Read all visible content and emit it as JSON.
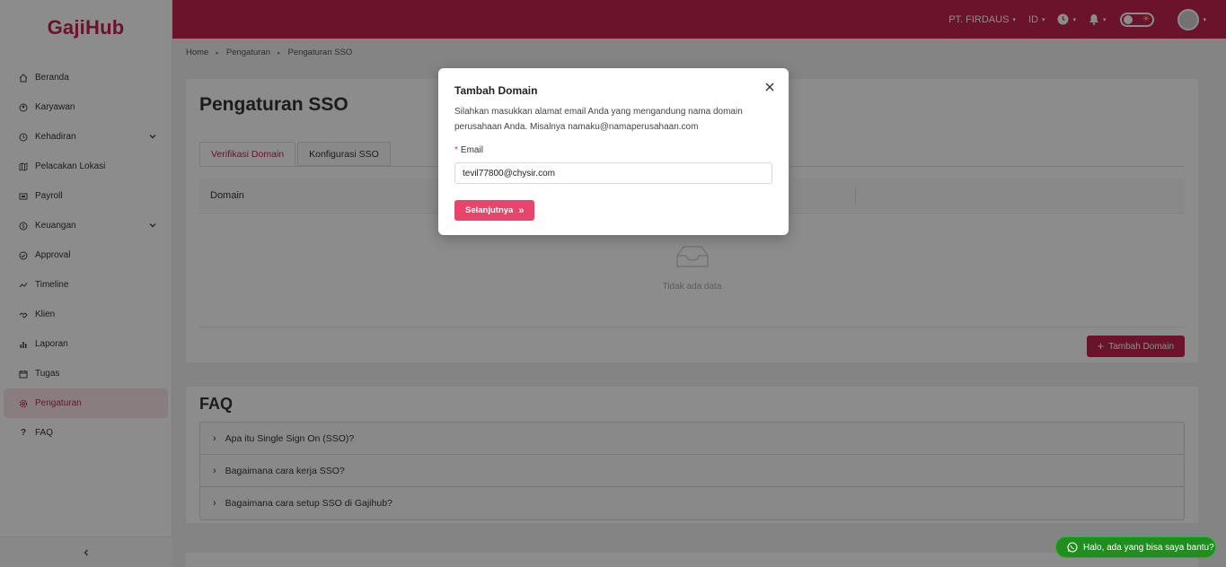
{
  "app": {
    "logo": "GajiHub"
  },
  "sidebar": {
    "items": [
      {
        "label": "Beranda",
        "icon": "home-icon"
      },
      {
        "label": "Karyawan",
        "icon": "users-icon"
      },
      {
        "label": "Kehadiran",
        "icon": "history-icon",
        "expandable": true
      },
      {
        "label": "Pelacakan Lokasi",
        "icon": "map-icon"
      },
      {
        "label": "Payroll",
        "icon": "payroll-icon"
      },
      {
        "label": "Keuangan",
        "icon": "dollar-icon",
        "expandable": true
      },
      {
        "label": "Approval",
        "icon": "check-circle-icon"
      },
      {
        "label": "Timeline",
        "icon": "line-chart-icon"
      },
      {
        "label": "Klien",
        "icon": "handshake-icon"
      },
      {
        "label": "Laporan",
        "icon": "bar-chart-icon"
      },
      {
        "label": "Tugas",
        "icon": "calendar-icon"
      },
      {
        "label": "Pengaturan",
        "icon": "gear-icon",
        "active": true
      },
      {
        "label": "FAQ",
        "icon": "question-icon"
      }
    ],
    "collapse_icon": "chevron-left-icon"
  },
  "topbar": {
    "company": "PT. FIRDAUS",
    "language": "ID",
    "theme_icon": "sun-icon"
  },
  "breadcrumb": [
    "Home",
    "Pengaturan",
    "Pengaturan SSO"
  ],
  "main": {
    "title": "Pengaturan SSO",
    "tabs": [
      {
        "label": "Verifikasi Domain",
        "active": true
      },
      {
        "label": "Konfigurasi SSO",
        "active": false
      }
    ],
    "table": {
      "columns": [
        "Domain"
      ],
      "empty_text": "Tidak ada data"
    },
    "add_button": "Tambah Domain"
  },
  "faq": {
    "title": "FAQ",
    "items": [
      "Apa itu Single Sign On (SSO)?",
      "Bagaimana cara kerja SSO?",
      "Bagaimana cara setup SSO di Gajihub?"
    ]
  },
  "modal": {
    "title": "Tambah Domain",
    "description": "Silahkan masukkan alamat email Anda yang mengandung nama domain perusahaan Anda. Misalnya namaku@namaperusahaan.com",
    "email_label": "Email",
    "email_required_mark": "*",
    "email_value": "tevil77800@chysir.com",
    "next_button": "Selanjutnya"
  },
  "chat": {
    "label": "Halo, ada yang bisa saya bantu?"
  },
  "colors": {
    "brand": "#c2244f",
    "button_pink": "#e8446c",
    "chat_green": "#1e8e1e"
  }
}
